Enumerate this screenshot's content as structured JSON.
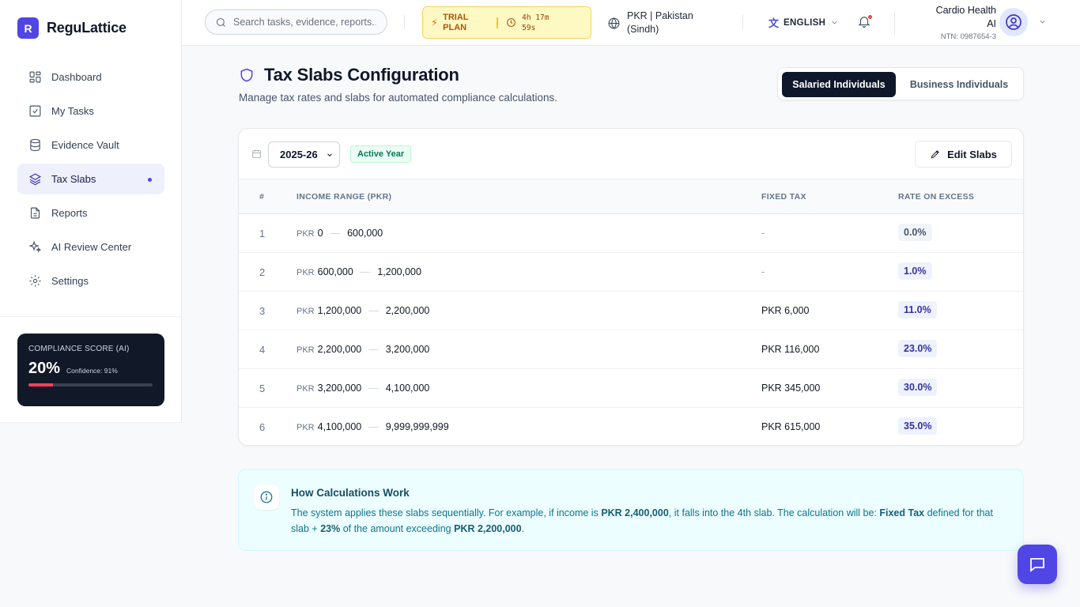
{
  "brand": {
    "logo_letter": "R",
    "name": "ReguLattice",
    "accent": "#4f46e5"
  },
  "sidebar": {
    "items": [
      {
        "label": "Dashboard",
        "icon": "dashboard-icon"
      },
      {
        "label": "My Tasks",
        "icon": "checkbox-icon"
      },
      {
        "label": "Evidence Vault",
        "icon": "database-icon"
      },
      {
        "label": "Tax Slabs",
        "icon": "layers-icon",
        "active": true
      },
      {
        "label": "Reports",
        "icon": "document-icon"
      },
      {
        "label": "AI Review Center",
        "icon": "sparkles-icon"
      },
      {
        "label": "Settings",
        "icon": "gear-icon"
      }
    ],
    "score": {
      "title": "COMPLIANCE SCORE (AI)",
      "value": "20%",
      "confidence": "Confidence: 91%",
      "progress": 0.2,
      "bar_color": "#f43f5e"
    }
  },
  "header": {
    "search_placeholder": "Search tasks, evidence, reports...",
    "trial": {
      "label": "TRIAL PLAN",
      "timer": "4h 17m 59s"
    },
    "region": "PKR | Pakistan (Sindh)",
    "language": "ENGLISH",
    "user": {
      "name": "Cardio Health AI",
      "ntn": "NTN: 0987654-3"
    }
  },
  "page": {
    "title": "Tax Slabs Configuration",
    "subtitle": "Manage tax rates and slabs for automated compliance calculations.",
    "segments": {
      "active": "Salaried Individuals",
      "inactive": "Business Individuals"
    }
  },
  "table": {
    "year": "2025-26",
    "year_badge": "Active Year",
    "edit_label": "Edit Slabs",
    "columns": {
      "num": "#",
      "range": "INCOME RANGE (PKR)",
      "fixed": "FIXED TAX",
      "rate": "RATE ON EXCESS"
    },
    "currency": "PKR",
    "rows": [
      {
        "num": "1",
        "from": "0",
        "to": "600,000",
        "fixed": "-",
        "rate": "0.0%"
      },
      {
        "num": "2",
        "from": "600,000",
        "to": "1,200,000",
        "fixed": "-",
        "rate": "1.0%"
      },
      {
        "num": "3",
        "from": "1,200,000",
        "to": "2,200,000",
        "fixed": "PKR 6,000",
        "rate": "11.0%"
      },
      {
        "num": "4",
        "from": "2,200,000",
        "to": "3,200,000",
        "fixed": "PKR 116,000",
        "rate": "23.0%"
      },
      {
        "num": "5",
        "from": "3,200,000",
        "to": "4,100,000",
        "fixed": "PKR 345,000",
        "rate": "30.0%"
      },
      {
        "num": "6",
        "from": "4,100,000",
        "to": "9,999,999,999",
        "fixed": "PKR 615,000",
        "rate": "35.0%"
      }
    ]
  },
  "info": {
    "title": "How Calculations Work",
    "t1": "The system applies these slabs sequentially. For example, if income is ",
    "b1": "PKR 2,400,000",
    "t2": ", it falls into the 4th slab. The calculation will be: ",
    "b2": "Fixed Tax",
    "t3": " defined for that slab + ",
    "b3": "23%",
    "t4": " of the amount exceeding ",
    "b4": "PKR 2,200,000",
    "t5": "."
  }
}
